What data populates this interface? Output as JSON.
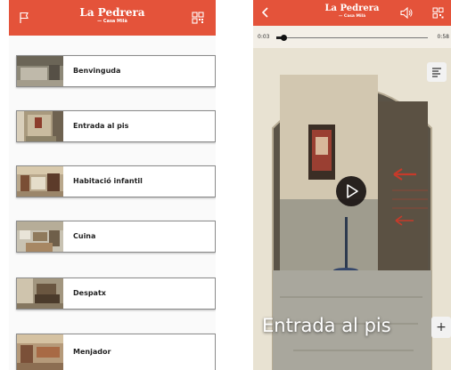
{
  "app": {
    "brand": "La Pedrera",
    "subbrand": "— Casa Milà"
  },
  "icons": {
    "flag": "flag-icon",
    "qr": "qr-code-icon",
    "back": "chevron-left-icon",
    "volume": "volume-icon",
    "play": "play-icon",
    "subtitles": "subtitles-icon",
    "plus": "+"
  },
  "colors": {
    "accent": "#e4533a",
    "header_text": "#ffffff"
  },
  "rooms": [
    {
      "label": "Benvinguda"
    },
    {
      "label": "Entrada al pis"
    },
    {
      "label": "Habitació infantil"
    },
    {
      "label": "Cuina"
    },
    {
      "label": "Despatx"
    },
    {
      "label": "Menjador"
    }
  ],
  "player": {
    "elapsed": "0:03",
    "duration": "0:58",
    "progress": 0.05,
    "room_title": "Entrada al pis"
  }
}
